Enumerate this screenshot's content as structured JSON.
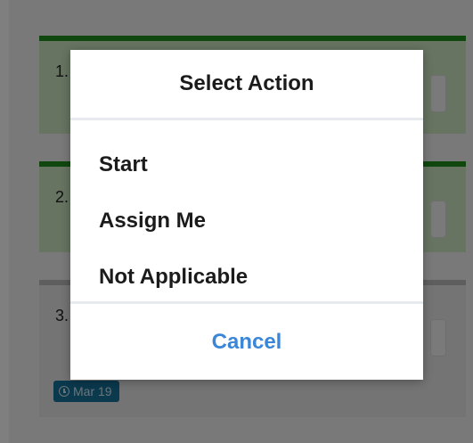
{
  "background": {
    "cards": [
      {
        "number": "1.",
        "status_color": "#1f8f1f"
      },
      {
        "number": "2.",
        "status_color": "#1f8f1f"
      },
      {
        "number": "3.",
        "status_color": "#bdbdbd"
      }
    ],
    "date_badge": {
      "text": "Mar 19",
      "icon": "clock-icon"
    }
  },
  "modal": {
    "title": "Select Action",
    "options": [
      {
        "label": "Start"
      },
      {
        "label": "Assign Me"
      },
      {
        "label": "Not Applicable"
      }
    ],
    "cancel_label": "Cancel"
  },
  "colors": {
    "overlay": "rgba(0,0,0,0.5)",
    "modal_background": "#ffffff",
    "cancel": "#3b86d8",
    "card_green": "#cfe8c2",
    "card_gray": "#e9e9e9",
    "badge": "#17739a"
  }
}
